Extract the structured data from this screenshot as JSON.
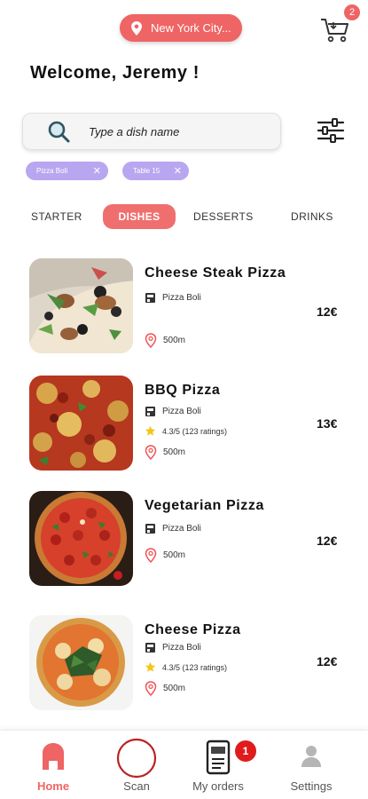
{
  "header": {
    "location": "New York City...",
    "cart_count": "2"
  },
  "welcome": "Welcome, Jeremy !",
  "search": {
    "placeholder": "Type a dish name"
  },
  "chips": [
    {
      "label": "Pizza Boli"
    },
    {
      "label": "Table 15"
    }
  ],
  "tabs": [
    {
      "label": "STARTER",
      "active": false
    },
    {
      "label": "DISHES",
      "active": true
    },
    {
      "label": "DESSERTS",
      "active": false
    },
    {
      "label": "DRINKS",
      "active": false
    }
  ],
  "items": [
    {
      "name": "Cheese Steak Pizza",
      "restaurant": "Pizza Boli",
      "rating": "",
      "distance": "500m",
      "price": "12€"
    },
    {
      "name": "BBQ Pizza",
      "restaurant": "Pizza Boli",
      "rating": "4.3/5 (123 ratings)",
      "distance": "500m",
      "price": "13€"
    },
    {
      "name": "Vegetarian Pizza",
      "restaurant": "Pizza Boli",
      "rating": "",
      "distance": "500m",
      "price": "12€"
    },
    {
      "name": "Cheese Pizza",
      "restaurant": "Pizza Boli",
      "rating": "4.3/5 (123 ratings)",
      "distance": "500m",
      "price": "12€"
    }
  ],
  "nav": [
    {
      "label": "Home",
      "icon": "home-icon",
      "active": true
    },
    {
      "label": "Scan",
      "icon": "scan-icon",
      "active": false
    },
    {
      "label": "My orders",
      "icon": "orders-icon",
      "active": false,
      "badge": "1"
    },
    {
      "label": "Settings",
      "icon": "user-icon",
      "active": false
    }
  ],
  "colors": {
    "accent": "#ef6464",
    "chip": "#b9a6f0",
    "badge": "#e01b1b"
  }
}
